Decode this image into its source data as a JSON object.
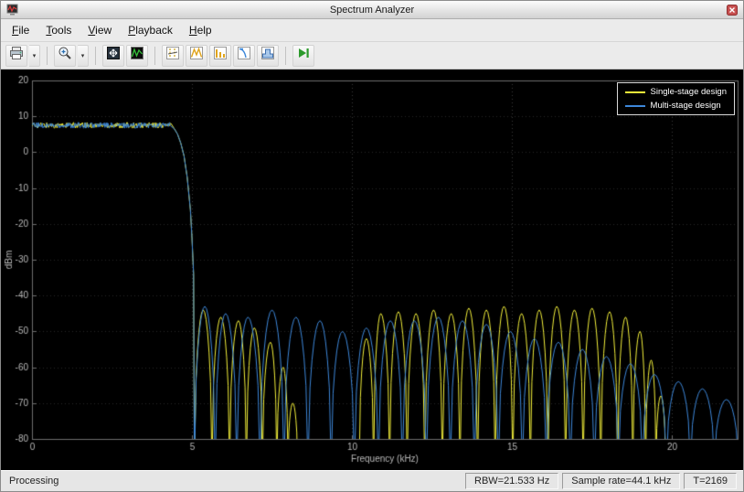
{
  "window": {
    "title": "Spectrum Analyzer"
  },
  "menus": [
    {
      "label": "File",
      "accel": "F"
    },
    {
      "label": "Tools",
      "accel": "T"
    },
    {
      "label": "View",
      "accel": "V"
    },
    {
      "label": "Playback",
      "accel": "P"
    },
    {
      "label": "Help",
      "accel": "H"
    }
  ],
  "toolbar": {
    "items": [
      {
        "name": "print-export",
        "icon": "printer-icon",
        "dropdown": true
      },
      {
        "name": "zoom",
        "icon": "zoom-in-icon",
        "dropdown": true
      },
      {
        "name": "fit-to-view",
        "icon": "fit-to-view-icon"
      },
      {
        "name": "spectrum-settings",
        "icon": "spectrum-settings-icon"
      },
      {
        "name": "cursor-measurements",
        "icon": "cursor-measurements-icon"
      },
      {
        "name": "peak-finder",
        "icon": "peak-finder-icon"
      },
      {
        "name": "distortion-measurements",
        "icon": "distortion-measurements-icon"
      },
      {
        "name": "ccdf-measurements",
        "icon": "ccdf-measurements-icon"
      },
      {
        "name": "spectral-mask",
        "icon": "spectral-mask-icon"
      },
      {
        "name": "step-forward",
        "icon": "step-forward-icon"
      }
    ],
    "dropdown_glyph": "▾"
  },
  "status": {
    "message": "Processing",
    "rbw": "RBW=21.533 Hz",
    "sample_rate": "Sample rate=44.1 kHz",
    "time": "T=2169"
  },
  "chart_data": {
    "type": "line",
    "title": "",
    "xlabel": "Frequency (kHz)",
    "ylabel": "dBm",
    "xlim": [
      0,
      22.05
    ],
    "ylim": [
      -80,
      20
    ],
    "xticks": [
      0,
      5,
      10,
      15,
      20
    ],
    "yticks": [
      20,
      10,
      0,
      -10,
      -20,
      -30,
      -40,
      -50,
      -60,
      -70,
      -80
    ],
    "grid": true,
    "legend_position": "northeast",
    "null_level": -88,
    "series": [
      {
        "name": "Single-stage design",
        "color": "#f2ef3a",
        "seed": 1,
        "passband": {
          "x0": 0,
          "x1": 4.35,
          "level": 7.5,
          "ripple": 1.6
        },
        "rolloff": [
          [
            4.45,
            6.5
          ],
          [
            4.55,
            5.0
          ],
          [
            4.65,
            2.5
          ],
          [
            4.75,
            -1.0
          ],
          [
            4.85,
            -7.0
          ],
          [
            4.95,
            -16.0
          ],
          [
            5.0,
            -24.0
          ],
          [
            5.05,
            -34.0
          ]
        ],
        "lobe_groups": [
          {
            "peaks": [
              [
                5.35,
                -44
              ],
              [
                5.9,
                -46
              ],
              [
                6.45,
                -47
              ],
              [
                6.95,
                -49
              ],
              [
                7.45,
                -53
              ],
              [
                7.85,
                -60
              ],
              [
                8.15,
                -70
              ]
            ]
          },
          {
            "peaks": [
              [
                10.45,
                -52
              ],
              [
                10.9,
                -45
              ],
              [
                11.45,
                -44.5
              ],
              [
                12.0,
                -45
              ],
              [
                12.55,
                -44
              ],
              [
                13.1,
                -45
              ],
              [
                13.65,
                -43.5
              ],
              [
                14.2,
                -44
              ],
              [
                14.75,
                -43
              ],
              [
                15.3,
                -45
              ],
              [
                15.85,
                -44
              ],
              [
                16.4,
                -43
              ],
              [
                16.95,
                -44
              ],
              [
                17.5,
                -43.5
              ],
              [
                18.05,
                -44.5
              ],
              [
                18.55,
                -46
              ],
              [
                19.0,
                -50
              ],
              [
                19.35,
                -58
              ],
              [
                19.65,
                -68
              ]
            ]
          }
        ]
      },
      {
        "name": "Multi-stage design",
        "color": "#3d87d9",
        "seed": 77,
        "passband": {
          "x0": 0,
          "x1": 4.35,
          "level": 7.5,
          "ripple": 1.6
        },
        "rolloff": [
          [
            4.45,
            6.5
          ],
          [
            4.55,
            5.0
          ],
          [
            4.65,
            2.5
          ],
          [
            4.75,
            -1.0
          ],
          [
            4.85,
            -7.0
          ],
          [
            4.95,
            -16.0
          ],
          [
            5.0,
            -24.0
          ],
          [
            5.05,
            -34.0
          ]
        ],
        "lobe_groups": [
          {
            "peaks": [
              [
                5.4,
                -43
              ],
              [
                6.05,
                -45
              ],
              [
                6.75,
                -46
              ],
              [
                7.5,
                -44
              ],
              [
                8.25,
                -46
              ],
              [
                9.0,
                -47
              ],
              [
                9.7,
                -50
              ],
              [
                10.45,
                -49
              ],
              [
                11.2,
                -47
              ],
              [
                11.95,
                -47
              ],
              [
                12.7,
                -46
              ],
              [
                13.45,
                -47
              ],
              [
                14.2,
                -48
              ],
              [
                14.95,
                -50
              ],
              [
                15.7,
                -52
              ],
              [
                16.45,
                -53
              ],
              [
                17.2,
                -55
              ],
              [
                17.95,
                -57
              ],
              [
                18.7,
                -59
              ],
              [
                19.45,
                -62
              ],
              [
                20.2,
                -64
              ],
              [
                20.95,
                -66
              ],
              [
                21.7,
                -69
              ]
            ]
          }
        ]
      }
    ]
  }
}
